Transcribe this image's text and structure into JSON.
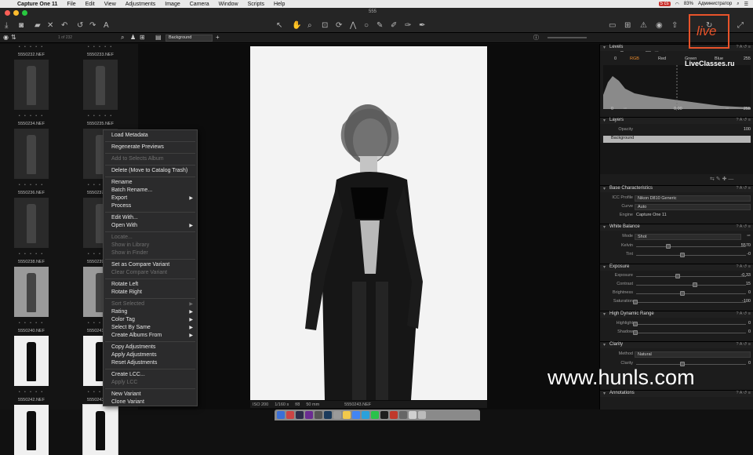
{
  "menubar": {
    "app": "Capture One 11",
    "items": [
      "File",
      "Edit",
      "View",
      "Adjustments",
      "Image",
      "Camera",
      "Window",
      "Scripts",
      "Help"
    ],
    "user": "Администратор",
    "battery": "83%",
    "status_badge": "5 cs"
  },
  "window": {
    "title": "555"
  },
  "browser_bar": {
    "count": "1 of 232",
    "variant_select": "Background"
  },
  "thumbnails": [
    {
      "name": "5550232.NEF",
      "stars": "• • • • •"
    },
    {
      "name": "5550233.NEF",
      "stars": "• • • • •"
    },
    {
      "name": "5550234.NEF",
      "stars": "• • • • •"
    },
    {
      "name": "5550235.NEF",
      "stars": "• • • • •"
    },
    {
      "name": "5550236.NEF",
      "stars": "• • • • •"
    },
    {
      "name": "5550237.NEF",
      "stars": "• • • • •"
    },
    {
      "name": "5550238.NEF",
      "stars": "• • • • •"
    },
    {
      "name": "5550239.NEF",
      "stars": "• • • • •"
    },
    {
      "name": "5550240.NEF",
      "stars": "• • • • •"
    },
    {
      "name": "5550241.NEF",
      "stars": "• • • • •"
    },
    {
      "name": "5550242.NEF",
      "stars": "• • • • •"
    },
    {
      "name": "5550243.NEF",
      "stars": "• • • • •"
    }
  ],
  "context_menu": [
    {
      "label": "Load Metadata",
      "enabled": true
    },
    {
      "sep": true
    },
    {
      "label": "Regenerate Previews",
      "enabled": true
    },
    {
      "sep": true
    },
    {
      "label": "Add to Selects Album",
      "enabled": false
    },
    {
      "sep": true
    },
    {
      "label": "Delete (Move to Catalog Trash)",
      "enabled": true
    },
    {
      "sep": true
    },
    {
      "label": "Rename",
      "enabled": true
    },
    {
      "label": "Batch Rename...",
      "enabled": true
    },
    {
      "label": "Export",
      "enabled": true,
      "submenu": true
    },
    {
      "label": "Process",
      "enabled": true
    },
    {
      "sep": true
    },
    {
      "label": "Edit With...",
      "enabled": true
    },
    {
      "label": "Open With",
      "enabled": true,
      "submenu": true
    },
    {
      "sep": true
    },
    {
      "label": "Locate...",
      "enabled": false
    },
    {
      "label": "Show in Library",
      "enabled": false
    },
    {
      "label": "Show in Finder",
      "enabled": false
    },
    {
      "sep": true
    },
    {
      "label": "Set as Compare Variant",
      "enabled": true
    },
    {
      "label": "Clear Compare Variant",
      "enabled": false
    },
    {
      "sep": true
    },
    {
      "label": "Rotate Left",
      "enabled": true
    },
    {
      "label": "Rotate Right",
      "enabled": true
    },
    {
      "sep": true
    },
    {
      "label": "Sort Selected",
      "enabled": false,
      "submenu": true
    },
    {
      "label": "Rating",
      "enabled": true,
      "submenu": true
    },
    {
      "label": "Color Tag",
      "enabled": true,
      "submenu": true
    },
    {
      "label": "Select By Same",
      "enabled": true,
      "submenu": true
    },
    {
      "label": "Create Albums From",
      "enabled": true,
      "submenu": true
    },
    {
      "sep": true
    },
    {
      "label": "Copy Adjustments",
      "enabled": true
    },
    {
      "label": "Apply Adjustments",
      "enabled": true
    },
    {
      "label": "Reset Adjustments",
      "enabled": true
    },
    {
      "sep": true
    },
    {
      "label": "Create LCC...",
      "enabled": true
    },
    {
      "label": "Apply LCC",
      "enabled": false
    },
    {
      "sep": true
    },
    {
      "label": "New Variant",
      "enabled": true
    },
    {
      "label": "Clone Variant",
      "enabled": true
    }
  ],
  "viewer": {
    "iso": "ISO 200",
    "shutter": "1/160 s",
    "aperture": "f/8",
    "focal": "50 mm",
    "filename": "5550243.NEF"
  },
  "inspector": {
    "levels": {
      "title": "Levels",
      "input_low": "0",
      "input_high": "255",
      "channels": [
        "RGB",
        "Red",
        "Green",
        "Blue"
      ],
      "out_low": "0",
      "mid": "0,00",
      "out_high": "255"
    },
    "layers": {
      "title": "Layers",
      "opacity_label": "Opacity",
      "opacity": "100",
      "layer": "Background"
    },
    "base": {
      "title": "Base Characteristics",
      "icc_label": "ICC Profile",
      "icc": "Nikon D810 Generic",
      "curve_label": "Curve",
      "curve": "Auto",
      "engine_label": "Engine",
      "engine": "Capture One 11"
    },
    "white_balance": {
      "title": "White Balance",
      "mode_label": "Mode",
      "mode": "Shot",
      "kelvin_label": "Kelvin",
      "kelvin": "5570",
      "tint_label": "Tint",
      "tint": "-0"
    },
    "exposure": {
      "title": "Exposure",
      "rows": [
        {
          "label": "Exposure",
          "value": "-0,33"
        },
        {
          "label": "Contrast",
          "value": "15"
        },
        {
          "label": "Brightness",
          "value": "0"
        },
        {
          "label": "Saturation",
          "value": "-100"
        }
      ]
    },
    "hdr": {
      "title": "High Dynamic Range",
      "rows": [
        {
          "label": "Highlight",
          "value": "0"
        },
        {
          "label": "Shadow",
          "value": "0"
        }
      ]
    },
    "clarity": {
      "title": "Clarity",
      "method_label": "Method",
      "method": "Natural",
      "clarity_label": "Clarity",
      "clarity": "0"
    },
    "annotations": {
      "title": "Annotations"
    }
  },
  "watermark": "www.hunls.com",
  "logo": {
    "mark": "live",
    "text": "LiveClasses.ru"
  }
}
